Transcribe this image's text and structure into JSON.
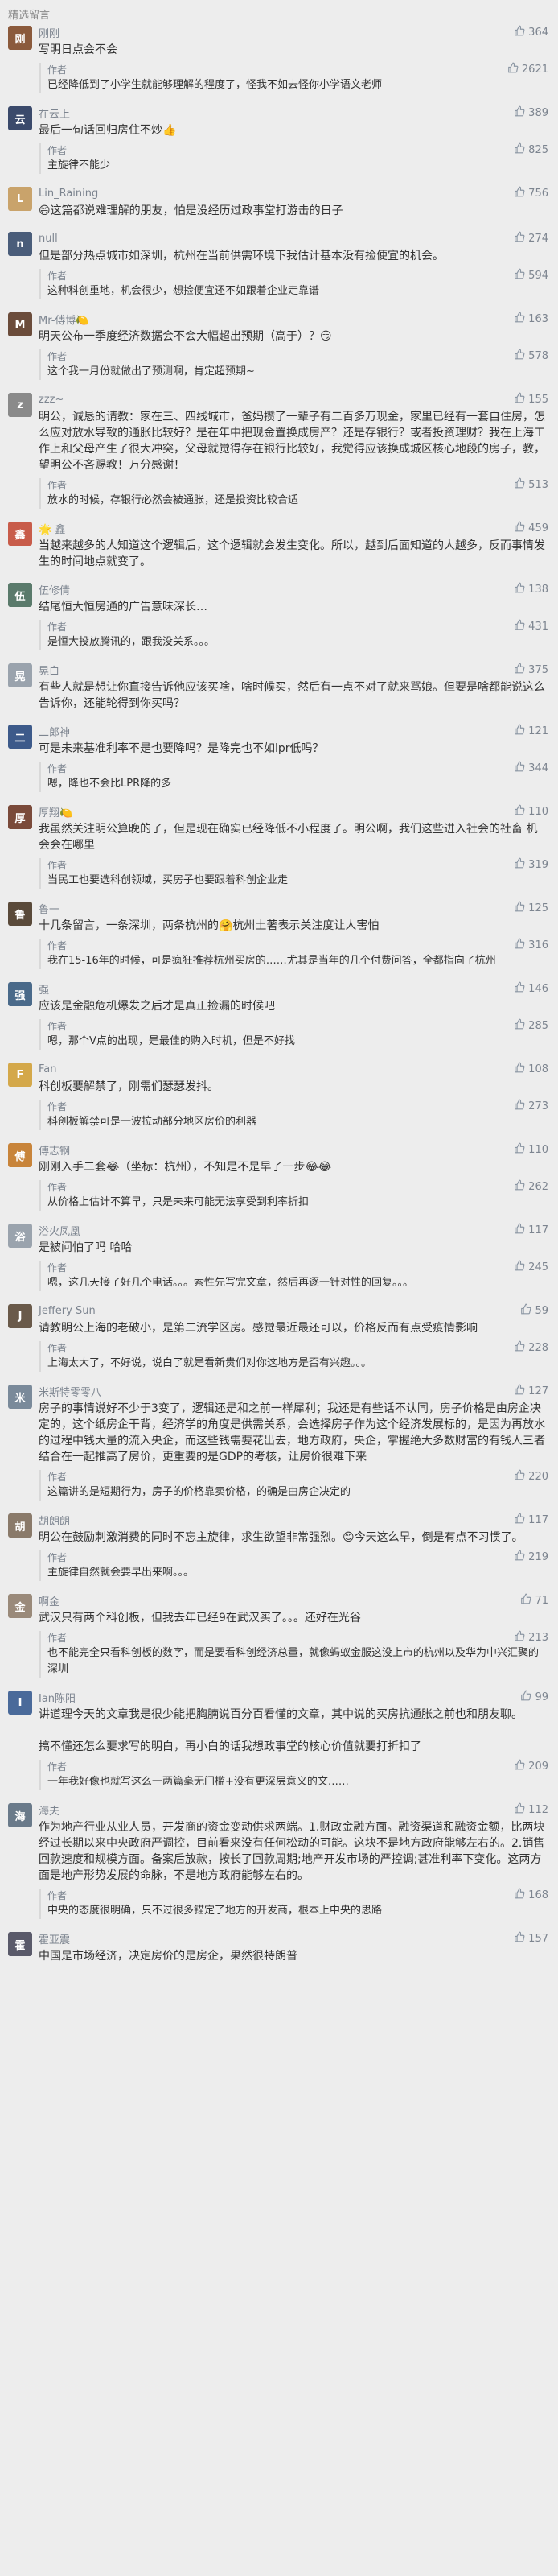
{
  "section_title": "精选留言",
  "author_label": "作者",
  "comments": [
    {
      "nick": "刚刚",
      "avatar_color": "#8b5a3c",
      "avatar_char": "刚",
      "likes": "364",
      "text": "写明日点会不会",
      "reply": "已经降低到了小学生就能够理解的程度了，怪我不如去怪你小学语文老师",
      "reply_likes": "2621"
    },
    {
      "nick": "在云上",
      "avatar_color": "#3b4a6b",
      "avatar_char": "云",
      "likes": "389",
      "text": "最后一句话回归房住不炒👍",
      "reply": "主旋律不能少",
      "reply_likes": "825"
    },
    {
      "nick": "Lin_Raining",
      "avatar_color": "#c9a36b",
      "avatar_char": "L",
      "likes": "756",
      "text": "😄这篇都说难理解的朋友，怕是没经历过政事堂打游击的日子",
      "reply": "",
      "reply_likes": ""
    },
    {
      "nick": "null",
      "avatar_color": "#4a5d7a",
      "avatar_char": "n",
      "likes": "274",
      "text": "但是部分热点城市如深圳，杭州在当前供需环境下我估计基本没有捡便宜的机会。",
      "reply": "这种科创重地，机会很少，想捡便宜还不如跟着企业走靠谱",
      "reply_likes": "594"
    },
    {
      "nick": "Mr-傅博🍋",
      "avatar_color": "#6b4c3b",
      "avatar_char": "M",
      "likes": "163",
      "text": "明天公布一季度经济数据会不会大幅超出预期（高于）？😏",
      "reply": "这个我一月份就做出了预测啊，肯定超预期~",
      "reply_likes": "578"
    },
    {
      "nick": "zzz~",
      "avatar_color": "#8a8a8a",
      "avatar_char": "z",
      "likes": "155",
      "text": "明公，诚恳的请教：家在三、四线城市，爸妈攒了一辈子有二百多万现金，家里已经有一套自住房，怎么应对放水导致的通胀比较好？是在年中把现金置换成房产？还是存银行？或者投资理财？我在上海工作上和父母产生了很大冲突，父母就觉得存在银行比较好，我觉得应该换成城区核心地段的房子，教，望明公不吝赐教！万分感谢！",
      "reply": "放水的时候，存银行必然会被通胀，还是投资比较合适",
      "reply_likes": "513"
    },
    {
      "nick": "🌟 鑫",
      "avatar_color": "#c85c4a",
      "avatar_char": "鑫",
      "likes": "459",
      "text": "当越来越多的人知道这个逻辑后，这个逻辑就会发生变化。所以，越到后面知道的人越多，反而事情发生的时间地点就变了。",
      "reply": "",
      "reply_likes": ""
    },
    {
      "nick": "伍修倩",
      "avatar_color": "#5a7a6b",
      "avatar_char": "伍",
      "likes": "138",
      "text": "结尾恒大恒房通的广告意味深长…",
      "reply": "是恒大投放腾讯的，跟我没关系。。。",
      "reply_likes": "431"
    },
    {
      "nick": "晃白",
      "avatar_color": "#9aa3ad",
      "avatar_char": "晃",
      "likes": "375",
      "text": "有些人就是想让你直接告诉他应该买啥，啥时候买，然后有一点不对了就来骂娘。但要是啥都能说这么告诉你，还能轮得到你买吗？",
      "reply": "",
      "reply_likes": ""
    },
    {
      "nick": "二郎神",
      "avatar_color": "#3d5a8a",
      "avatar_char": "二",
      "likes": "121",
      "text": "可是未来基准利率不是也要降吗？是降完也不如lpr低吗？",
      "reply": "嗯，降也不会比LPR降的多",
      "reply_likes": "344"
    },
    {
      "nick": "厚翔🍋",
      "avatar_color": "#7a4a3a",
      "avatar_char": "厚",
      "likes": "110",
      "text": "我虽然关注明公算晚的了，但是现在确实已经降低不小程度了。明公啊，我们这些进入社会的社畜 机会会在哪里",
      "reply": "当民工也要选科创领域，买房子也要跟着科创企业走",
      "reply_likes": "319"
    },
    {
      "nick": "鲁一",
      "avatar_color": "#5a4a3a",
      "avatar_char": "鲁",
      "likes": "125",
      "text": "十几条留言，一条深圳，两条杭州的🤗杭州土著表示关注度让人害怕",
      "reply": "我在15-16年的时候，可是疯狂推荐杭州买房的……尤其是当年的几个付费问答，全都指向了杭州",
      "reply_likes": "316"
    },
    {
      "nick": "强",
      "avatar_color": "#4a6a8a",
      "avatar_char": "强",
      "likes": "146",
      "text": "应该是金融危机爆发之后才是真正捡漏的时候吧",
      "reply": "嗯，那个V点的出现，是最佳的购入时机，但是不好找",
      "reply_likes": "285"
    },
    {
      "nick": "Fan",
      "avatar_color": "#d4a84a",
      "avatar_char": "F",
      "likes": "108",
      "text": "科创板要解禁了，刚需们瑟瑟发抖。",
      "reply": "科创板解禁可是一波拉动部分地区房价的利器",
      "reply_likes": "273"
    },
    {
      "nick": "傅志钢",
      "avatar_color": "#c8843a",
      "avatar_char": "傅",
      "likes": "110",
      "text": "刚刚入手二套😂（坐标：杭州），不知是不是早了一步😂😂",
      "reply": "从价格上估计不算早，只是未来可能无法享受到利率折扣",
      "reply_likes": "262"
    },
    {
      "nick": "浴火凤凰",
      "avatar_color": "#9aa3ad",
      "avatar_char": "浴",
      "likes": "117",
      "text": "是被问怕了吗 哈哈",
      "reply": "嗯，这几天接了好几个电话。。。索性先写完文章，然后再逐一针对性的回复。。。",
      "reply_likes": "245"
    },
    {
      "nick": "Jeffery Sun",
      "avatar_color": "#6a5a4a",
      "avatar_char": "J",
      "likes": "59",
      "text": "请教明公上海的老破小，是第二流学区房。感觉最近最还可以，价格反而有点受疫情影响",
      "reply": "上海太大了，不好说，说白了就是看新贵们对你这地方是否有兴趣。。。",
      "reply_likes": "228"
    },
    {
      "nick": "米斯特零零八",
      "avatar_color": "#7a8a9a",
      "avatar_char": "米",
      "likes": "127",
      "text": "房子的事情说好不少于3变了，逻辑还是和之前一样犀利；我还是有些话不认同，房子价格是由房企决定的，这个纸房企干背，经济学的角度是供需关系，会选择房子作为这个经济发展标的，是因为再放水的过程中钱大量的流入央企，而这些钱需要花出去，地方政府，央企，掌握绝大多数财富的有钱人三者结合在一起推高了房价，更重要的是GDP的考核，让房价很难下来",
      "reply": "这篇讲的是短期行为，房子的价格靠卖价格，的确是由房企决定的",
      "reply_likes": "220"
    },
    {
      "nick": "胡朗朗",
      "avatar_color": "#8a7a6a",
      "avatar_char": "胡",
      "likes": "117",
      "text": "明公在鼓励刺激消费的同时不忘主旋律，求生欲望非常强烈。😊今天这么早，倒是有点不习惯了。",
      "reply": "主旋律自然就会要早出来啊。。。",
      "reply_likes": "219"
    },
    {
      "nick": "啊金",
      "avatar_color": "#9a8a7a",
      "avatar_char": "金",
      "likes": "71",
      "text": "武汉只有两个科创板，但我去年已经9在武汉买了。。。还好在光谷",
      "reply": "也不能完全只看科创板的数字，而是要看科创经济总量，就像蚂蚁金服这没上市的杭州以及华为中兴汇聚的深圳",
      "reply_likes": "213"
    },
    {
      "nick": "Ian陈阳",
      "avatar_color": "#4a6a9a",
      "avatar_char": "I",
      "likes": "99",
      "text": "讲道理今天的文章我是很少能把胸腩说百分百看懂的文章，其中说的买房抗通胀之前也和朋友聊。\n\n搞不懂还怎么要求写的明白，再小白的话我想政事堂的核心价值就要打折扣了",
      "reply": "一年我好像也就写这么一两篇毫无门槛+没有更深层意义的文……",
      "reply_likes": "209"
    },
    {
      "nick": "海夫",
      "avatar_color": "#6a7a8a",
      "avatar_char": "海",
      "likes": "112",
      "text": "作为地产行业从业人员，开发商的资金变动供求两端。1.财政金融方面。融资渠道和融资金额，比两块经过长期以来中央政府严调控，目前看来没有任何松动的可能。这块不是地方政府能够左右的。2.销售回款速度和规模方面。备案后放款，按长了回款周期;地产开发市场的严控调;甚准利率下变化。这两方面是地产形势发展的命脉，不是地方政府能够左右的。",
      "reply": "中央的态度很明确，只不过很多锚定了地方的开发商，根本上中央的思路",
      "reply_likes": "168"
    },
    {
      "nick": "霍亚震",
      "avatar_color": "#5a5a6a",
      "avatar_char": "霍",
      "likes": "157",
      "text": "中国是市场经济，决定房价的是房企，果然很特朗普",
      "reply": "",
      "reply_likes": ""
    }
  ]
}
